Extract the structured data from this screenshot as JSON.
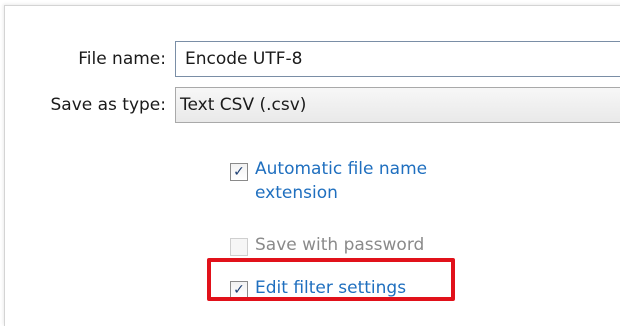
{
  "form": {
    "file_name_label": "File name:",
    "file_name_value": "Encode UTF-8",
    "save_as_type_label": "Save as type:",
    "save_as_type_value": "Text CSV (.csv)"
  },
  "options": {
    "auto_extension": {
      "label": "Automatic file name extension",
      "checked": true,
      "mark": "✓"
    },
    "save_with_password": {
      "label": "Save with password",
      "checked": false,
      "enabled": false
    },
    "edit_filter_settings": {
      "label": "Edit filter settings",
      "checked": true,
      "mark": "✓"
    }
  },
  "colors": {
    "link_blue": "#1f6fbf",
    "highlight_red": "#e1111a",
    "disabled_gray": "#8a8a8a"
  }
}
